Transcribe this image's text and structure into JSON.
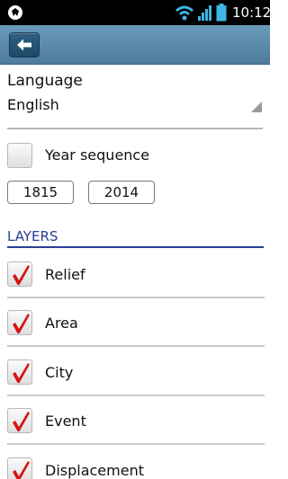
{
  "status_bar": {
    "time": "10:12",
    "icons": [
      "app-icon",
      "wifi-icon",
      "signal-icon",
      "battery-icon"
    ]
  },
  "action_bar": {
    "back_icon": "arrow-left-icon",
    "color": "#5a88a8"
  },
  "language": {
    "label": "Language",
    "selected": "English"
  },
  "year_sequence": {
    "label": "Year sequence",
    "checked": false,
    "start_year": "1815",
    "end_year": "2014"
  },
  "layers": {
    "header": "LAYERS",
    "header_color": "#2a3f95",
    "items": [
      {
        "label": "Relief",
        "checked": true
      },
      {
        "label": "Area",
        "checked": true
      },
      {
        "label": "City",
        "checked": true
      },
      {
        "label": "Event",
        "checked": true
      },
      {
        "label": "Displacement",
        "checked": true
      }
    ]
  },
  "colors": {
    "check_mark": "#d41414"
  }
}
